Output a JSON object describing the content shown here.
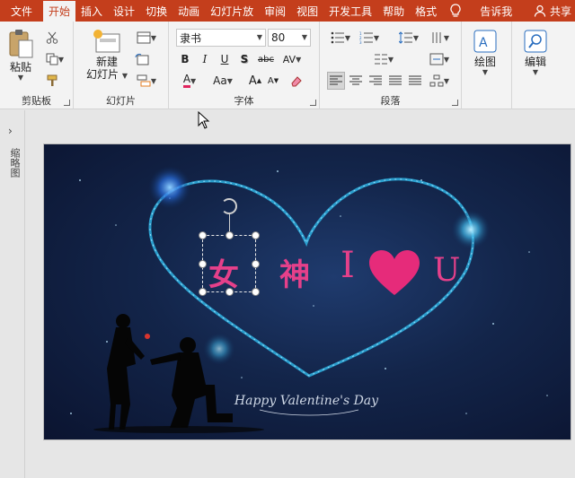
{
  "tabs": [
    "文件",
    "开始",
    "插入",
    "设计",
    "切换",
    "动画",
    "幻灯片放",
    "审阅",
    "视图",
    "开发工具",
    "帮助",
    "格式"
  ],
  "active_tab": "开始",
  "tell_me": "告诉我",
  "share": "共享",
  "clipboard": {
    "paste": "粘贴",
    "label": "剪贴板"
  },
  "slides_group": {
    "new_slide_line1": "新建",
    "new_slide_line2": "幻灯片",
    "label": "幻灯片"
  },
  "font_group": {
    "font_name": "隶书",
    "font_size": "80",
    "label": "字体",
    "bold": "B",
    "italic": "I",
    "underline": "U",
    "shadow": "S",
    "strike": "abc",
    "spacing": "AV",
    "case": "Aa",
    "grow": "A",
    "shrink": "A",
    "color_a": "A"
  },
  "paragraph_group": {
    "label": "段落"
  },
  "drawing": {
    "label": "绘图"
  },
  "editing": {
    "label": "编辑"
  },
  "thumbnail_pane": {
    "label": "缩略图"
  },
  "slide": {
    "title_chars": [
      "女",
      "神",
      "I",
      "U"
    ],
    "greeting": "Happy Valentine's Day"
  },
  "colors": {
    "accent": "#c43e1c",
    "slide_text": "#e5408a",
    "heart": "#e62b7a"
  }
}
